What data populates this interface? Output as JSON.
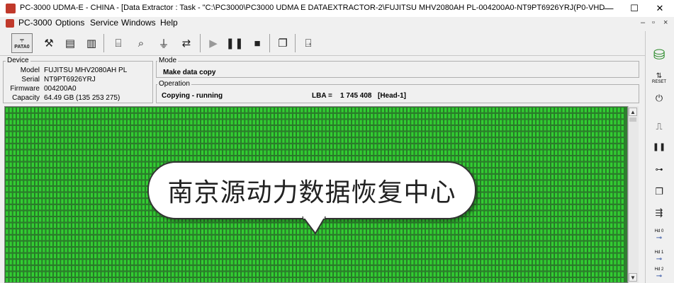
{
  "window": {
    "title": "PC-3000 UDMA-E - CHINA - [Data Extractor : Task - \"C:\\PC3000\\PC3000 UDMA E DATAEXTRACTOR-2\\FUJITSU MHV2080AH PL-004200A0-NT9PT6926YRJ(P0-VHD",
    "minimize": "—",
    "maximize": "☐",
    "close": "✕"
  },
  "menu": {
    "items": [
      "PC-3000",
      "Options",
      "Service",
      "Windows",
      "Help"
    ],
    "mdi_controls": [
      "–",
      "▫",
      "×"
    ]
  },
  "toolbar": {
    "patao_label": "PATA0"
  },
  "device": {
    "group_label": "Device",
    "rows": [
      {
        "label": "Model",
        "value": "FUJITSU MHV2080AH PL"
      },
      {
        "label": "Serial",
        "value": "NT9PT6926YRJ"
      },
      {
        "label": "Firmware",
        "value": "004200A0"
      },
      {
        "label": "Capacity",
        "value": "64.49 GB (135 253 275)"
      }
    ]
  },
  "mode": {
    "group_label": "Mode",
    "value": "Make data copy"
  },
  "operation": {
    "group_label": "Operation",
    "status": "Copying - running",
    "lba_label": "LBA =",
    "lba_value": "1 745 408",
    "head": "[Head-1]"
  },
  "right_toolbar": {
    "reset_label": "RESET",
    "head_labels": [
      "Hd 0",
      "Hd 1",
      "Hd 2"
    ]
  },
  "callout": {
    "text": "南京源动力数据恢复中心"
  },
  "colors": {
    "sector_fill": "#33cc33",
    "sector_border": "#1e6b1e",
    "grid_background": "#2f7d2f"
  }
}
